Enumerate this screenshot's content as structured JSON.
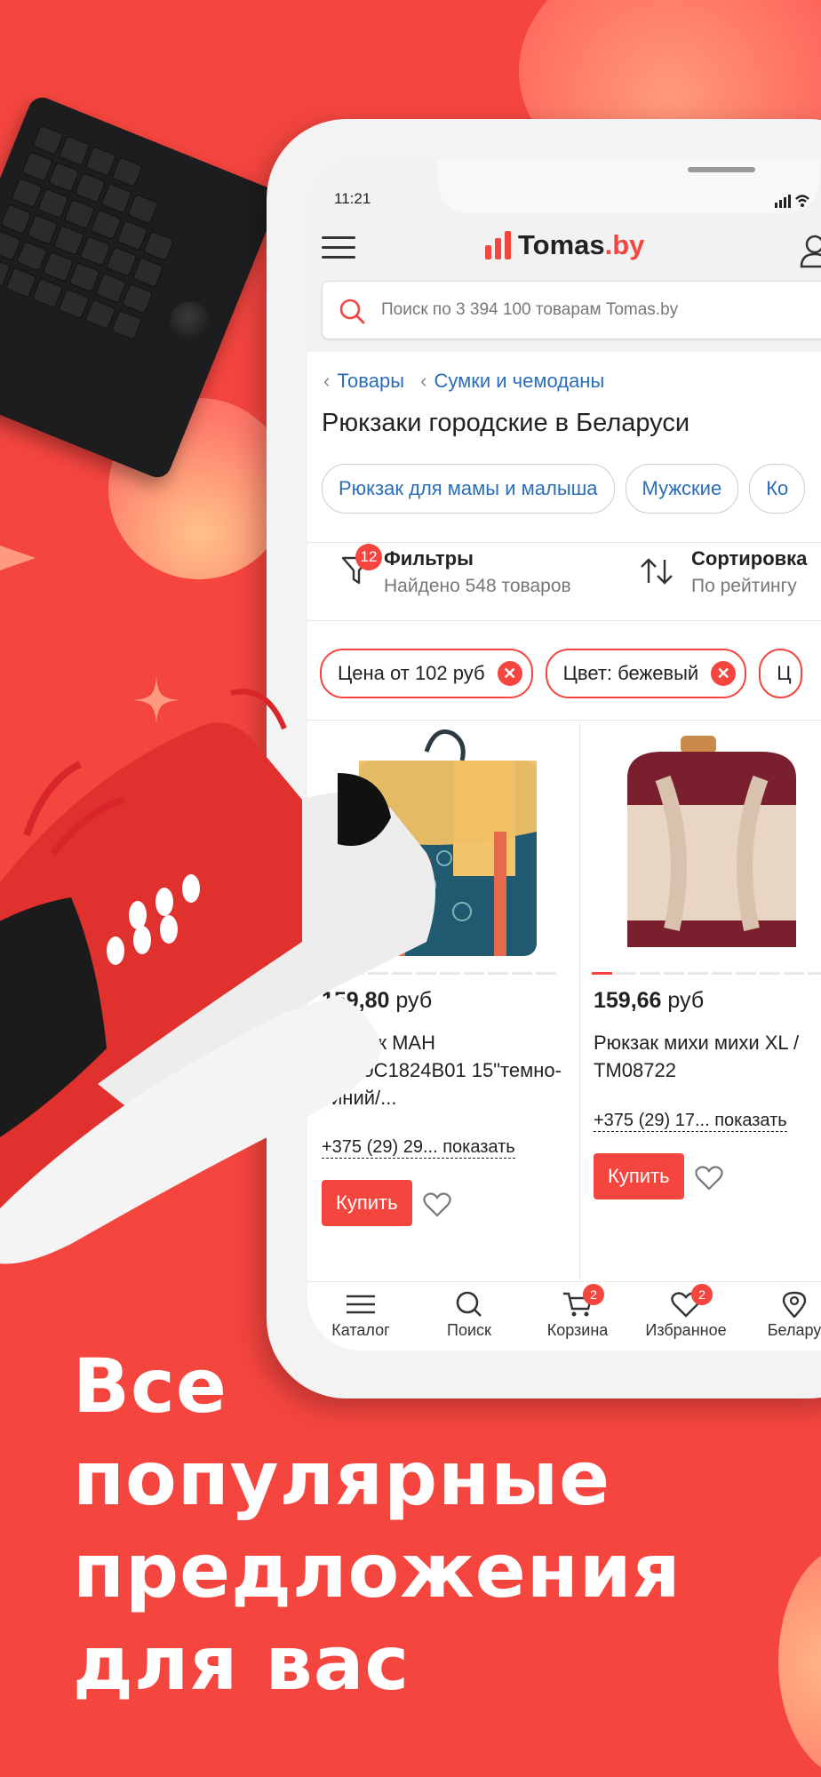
{
  "status": {
    "time": "11:21"
  },
  "header": {
    "logo_text": "Tomas",
    "logo_domain": ".by"
  },
  "search": {
    "placeholder": "Поиск по 3 394 100 товарам Tomas.by"
  },
  "breadcrumb": {
    "items": [
      "Товары",
      "Сумки и чемоданы"
    ]
  },
  "page": {
    "title": "Рюкзаки городские в Беларуси"
  },
  "chips": [
    "Рюкзак для мамы и малыша",
    "Мужские",
    "Ко"
  ],
  "filters": {
    "label": "Фильтры",
    "count": "12",
    "found": "Найдено 548 товаров"
  },
  "sort": {
    "label": "Сортировка",
    "value": "По рейтингу"
  },
  "active_filters": [
    "Цена от 102 руб",
    "Цвет: бежевый",
    "Ц"
  ],
  "products": [
    {
      "price": "159,80",
      "currency": "руб",
      "name": "Рюкзак MAH MR19C1824B01 15\"темно-синий/...",
      "phone": "+375 (29) 29... показать",
      "buy": "Купить"
    },
    {
      "price": "159,66",
      "currency": "руб",
      "name": "Рюкзак михи михи XL / TM08722",
      "phone": "+375 (29) 17... показать",
      "buy": "Купить"
    }
  ],
  "tabbar": {
    "catalog": "Каталог",
    "search": "Поиск",
    "cart": "Корзина",
    "cart_count": "2",
    "favorites": "Избранное",
    "favorites_count": "2",
    "location": "Белару"
  },
  "promo": {
    "line1": "Все",
    "line2": "популярные",
    "line3": "предложения",
    "line4": "для вас"
  },
  "colors": {
    "accent": "#f5453f",
    "link": "#2a6ebb",
    "text": "#222222"
  },
  "icons": [
    "menu-icon",
    "user-icon",
    "search-icon",
    "chevron-left-icon",
    "filter-icon",
    "sort-icon",
    "close-icon",
    "heart-icon",
    "cart-icon",
    "location-icon"
  ]
}
